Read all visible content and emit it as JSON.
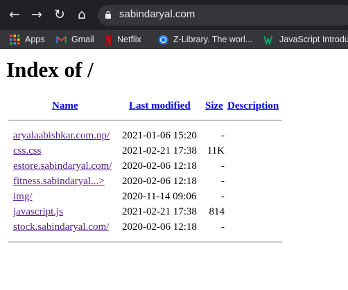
{
  "browser": {
    "url": "sabindaryal.com",
    "bookmarks": [
      {
        "label": "Apps",
        "icon": "apps-grid-icon"
      },
      {
        "label": "Gmail",
        "icon": "gmail-icon"
      },
      {
        "label": "Netflix",
        "icon": "netflix-icon"
      },
      {
        "label": "Z-Library. The worl...",
        "icon": "globe-icon"
      },
      {
        "label": "JavaScript Introduc",
        "icon": "w3-icon"
      }
    ]
  },
  "page": {
    "title": "Index of /",
    "columns": {
      "name": "Name",
      "modified": "Last modified",
      "size": "Size",
      "description": "Description"
    },
    "entries": [
      {
        "name": "aryalaabishkar.com.np/",
        "modified": "2021-01-06 15:20",
        "size": "-"
      },
      {
        "name": "css.css",
        "modified": "2021-02-21 17:38",
        "size": "11K"
      },
      {
        "name": "estore.sabindaryal.com/",
        "modified": "2020-02-06 12:18",
        "size": "-"
      },
      {
        "name": "fitness.sabindaryal...>",
        "modified": "2020-02-06 12:18",
        "size": "-"
      },
      {
        "name": "img/",
        "modified": "2020-11-14 09:06",
        "size": "-"
      },
      {
        "name": "javascript.js",
        "modified": "2021-02-21 17:38",
        "size": "814"
      },
      {
        "name": "stock.sabindaryal.com/",
        "modified": "2020-02-06 12:18",
        "size": "-"
      }
    ]
  }
}
